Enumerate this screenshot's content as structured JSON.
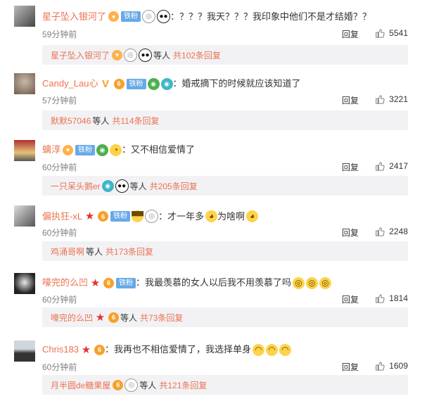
{
  "comments": [
    {
      "username": "星子坠入银河了",
      "fan_badge": "铁粉",
      "text": "：？？？我天？？？我印象中他们不是才结婚？？",
      "time": "59分钟前",
      "reply_label": "回复",
      "likes": "5541",
      "sub_reply": {
        "name": "星子坠入银河了",
        "text": "等人",
        "more": "共102条回复"
      }
    },
    {
      "username": "Candy_Lau心",
      "fan_badge": "铁粉",
      "text": "：婚戒摘下的时候就应该知道了",
      "time": "57分钟前",
      "reply_label": "回复",
      "likes": "3221",
      "sub_reply": {
        "name": "默默57046",
        "text": "等人",
        "more": "共114条回复"
      }
    },
    {
      "username": "螭淳",
      "fan_badge": "铁粉",
      "text": "：又不相信爱情了",
      "time": "60分钟前",
      "reply_label": "回复",
      "likes": "2417",
      "sub_reply": {
        "name": "一只呆头鹅er",
        "text": "等人",
        "more": "共205条回复"
      }
    },
    {
      "username": "偏执狂-xL",
      "fan_badge": "铁粉",
      "text": "：才一年多",
      "text2": "为啥啊",
      "time": "60分钟前",
      "reply_label": "回复",
      "likes": "2248",
      "sub_reply": {
        "name": "鸡涌哥啊",
        "text": "等人",
        "more": "共173条回复"
      }
    },
    {
      "username": "嚎完的么凹",
      "fan_badge": "铁粉",
      "text": "：我最羡慕的女人以后我不用羡慕了吗",
      "time": "60分钟前",
      "reply_label": "回复",
      "likes": "1814",
      "sub_reply": {
        "name": "嚎完的么凹",
        "text": "等人",
        "more": "共73条回复"
      }
    },
    {
      "username": "Chris183",
      "text": "：我再也不相信爱情了，我选择单身",
      "time": "60分钟前",
      "reply_label": "回复",
      "likes": "1609",
      "sub_reply": {
        "name": "月半圆de糖果屋",
        "text": "等人",
        "more": "共121条回复"
      }
    }
  ],
  "colors": {
    "username": "#eb7350",
    "fan_badge": "#68a9e7",
    "sub_bg": "#f2f2f5",
    "muted": "#808080"
  }
}
